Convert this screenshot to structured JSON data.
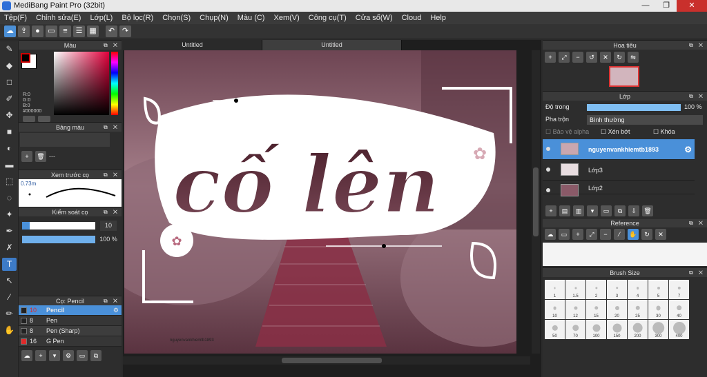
{
  "window": {
    "title": "MediBang Paint Pro (32bit)",
    "min": "—",
    "max": "❐",
    "close": "✕"
  },
  "menu": [
    "Tệp(F)",
    "Chỉnh sửa(E)",
    "Lớp(L)",
    "Bộ lọc(R)",
    "Chọn(S)",
    "Chụp(N)",
    "Màu (C)",
    "Xem(V)",
    "Công cụ(T)",
    "Cửa sổ(W)",
    "Cloud",
    "Help"
  ],
  "tabs": [
    "Untitled",
    "Untitled"
  ],
  "color_panel": {
    "title": "Màu",
    "r": "R:0",
    "g": "G:0",
    "b": "B:0",
    "hex": "#000000",
    "fg": "#000000",
    "bg": "#ffffff",
    "accent": "#e4003c"
  },
  "palette_panel": {
    "title": "Bảng màu",
    "dash": "---"
  },
  "preview_panel": {
    "title": "Xem trước cọ",
    "size": "0.73m"
  },
  "control_panel": {
    "title": "Kiểm soát cọ",
    "size": "10",
    "opacity": "100 %",
    "size_fraction": 0.1,
    "opacity_fraction": 1.0
  },
  "brush_panel": {
    "title": "Cọ: Pencil",
    "items": [
      {
        "size": "10",
        "name": "Pencil",
        "color": "#222222",
        "selected": true
      },
      {
        "size": "8",
        "name": "Pen",
        "color": "#222222",
        "selected": false
      },
      {
        "size": "8",
        "name": "Pen (Sharp)",
        "color": "#222222",
        "selected": false
      },
      {
        "size": "16",
        "name": "G Pen",
        "color": "#e02a2a",
        "selected": false
      }
    ]
  },
  "navigator": {
    "title": "Hoa tiêu"
  },
  "layers": {
    "title": "Lớp",
    "opacity_label": "Độ trong",
    "opacity_value": "100 %",
    "blend_label": "Pha trộn",
    "blend_value": "Bình thường",
    "protect_alpha": "Bảo vệ alpha",
    "clipping": "Xén bớt",
    "lock": "Khóa",
    "items": [
      "nguyenvankhiemtb1893",
      "Lớp3",
      "Lớp2"
    ]
  },
  "reference": {
    "title": "Reference"
  },
  "brush_size": {
    "title": "Brush Size",
    "sizes": [
      "1",
      "1.5",
      "2",
      "3",
      "4",
      "5",
      "7",
      "10",
      "12",
      "15",
      "20",
      "25",
      "30",
      "40",
      "50",
      "70",
      "100",
      "150",
      "200",
      "300",
      "400"
    ]
  },
  "artwork": {
    "title_line1": "cố lên",
    "signature": "nguyenvankhiemtb1893"
  }
}
